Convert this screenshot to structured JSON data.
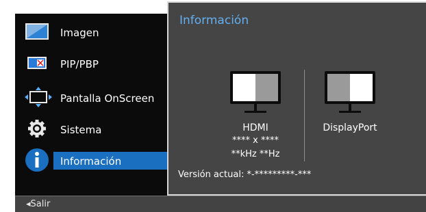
{
  "menu": {
    "items": [
      {
        "label": "Imagen",
        "icon": "picture-icon"
      },
      {
        "label": "PIP/PBP",
        "icon": "pip-icon"
      },
      {
        "label": "Pantalla OnScreen",
        "icon": "onscreen-display-icon"
      },
      {
        "label": "Sistema",
        "icon": "gear-icon"
      },
      {
        "label": "Información",
        "icon": "info-icon",
        "selected": true
      }
    ]
  },
  "bottom_bar": {
    "back_label": "◂Salir"
  },
  "panel": {
    "title": "Información",
    "hdmi": {
      "name": "HDMI",
      "resolution": "**** x ****",
      "frequency": "**kHz **Hz"
    },
    "displayport": {
      "name": "DisplayPort"
    },
    "version": "Versión actual: *-*********-***"
  },
  "colors": {
    "menu_bg": "#0b0b0b",
    "panel_bg": "#454545",
    "selection": "#1a6fc0",
    "title": "#64aff0",
    "bottom_bar": "#434343"
  }
}
